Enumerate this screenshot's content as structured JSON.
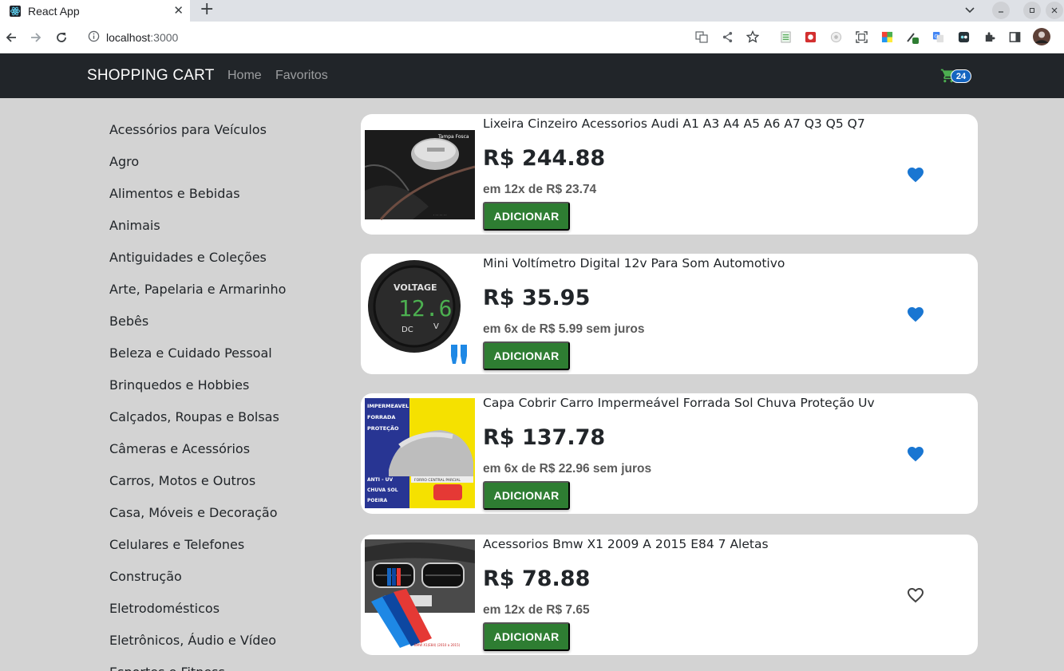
{
  "browser": {
    "tab_title": "React App",
    "tab_close": "✕",
    "new_tab": "+",
    "url_host": "localhost",
    "url_port": ":3000"
  },
  "navbar": {
    "brand": "SHOPPING CART",
    "links": [
      "Home",
      "Favoritos"
    ],
    "cart_count": "24"
  },
  "categories": [
    "Acessórios para Veículos",
    "Agro",
    "Alimentos e Bebidas",
    "Animais",
    "Antiguidades e Coleções",
    "Arte, Papelaria e Armarinho",
    "Bebês",
    "Beleza e Cuidado Pessoal",
    "Brinquedos e Hobbies",
    "Calçados, Roupas e Bolsas",
    "Câmeras e Acessórios",
    "Carros, Motos e Outros",
    "Casa, Móveis e Decoração",
    "Celulares e Telefones",
    "Construção",
    "Eletrodomésticos",
    "Eletrônicos, Áudio e Vídeo",
    "Esportes e Fitness"
  ],
  "products": [
    {
      "title": "Lixeira Cinzeiro Acessorios Audi A1 A3 A4 A5 A6 A7 Q3 Q5 Q7",
      "price": "R$ 244.88",
      "installments": "em 12x de R$ 23.74",
      "button": "ADICIONAR",
      "favorited": true,
      "image_text": "Tampa Fosca"
    },
    {
      "title": "Mini Voltímetro Digital 12v Para Som Automotivo",
      "price": "R$ 35.95",
      "installments": "em 6x de R$ 5.99 sem juros",
      "button": "ADICIONAR",
      "favorited": true,
      "image_text": "VOLTAGE"
    },
    {
      "title": "Capa Cobrir Carro Impermeável Forrada Sol Chuva Proteção Uv",
      "price": "R$ 137.78",
      "installments": "em 6x de R$ 22.96 sem juros",
      "button": "ADICIONAR",
      "favorited": true,
      "image_text": "IMPERMEAVEL"
    },
    {
      "title": "Acessorios Bmw X1 2009 A 2015 E84 7 Aletas",
      "price": "R$ 78.88",
      "installments": "em 12x de R$ 7.65",
      "button": "ADICIONAR",
      "favorited": false,
      "image_text": ""
    }
  ],
  "colors": {
    "navbar_bg": "#212529",
    "page_bg": "#d3d3d3",
    "button_green": "#2e7d32",
    "heart_blue": "#1976d2",
    "badge_blue": "#1565c0"
  },
  "icons": {
    "cart": "shopping-cart-icon",
    "favorite_filled": "heart-filled-icon",
    "favorite_outline": "heart-outline-icon"
  }
}
